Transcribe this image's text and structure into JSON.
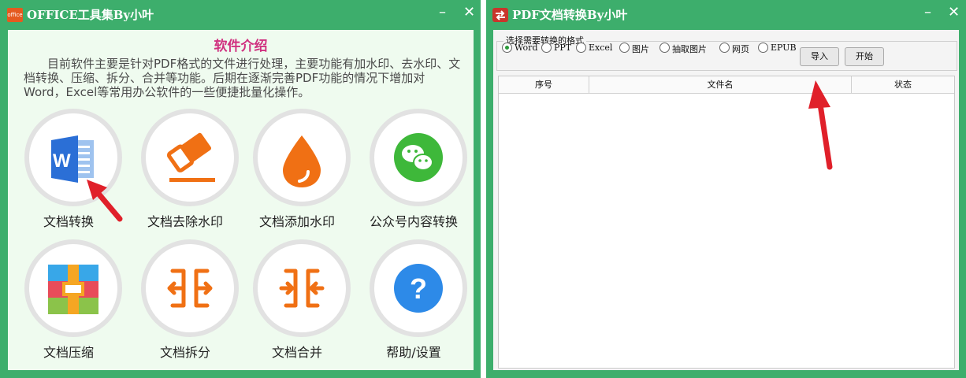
{
  "window_left": {
    "title": "OFFICE工具集By小叶",
    "logo_text": "office",
    "minimize": "–",
    "close": "✕",
    "intro_title": "软件介绍",
    "intro_text": "目前软件主要是针对PDF格式的文件进行处理，主要功能有加水印、去水印、文档转换、压缩、拆分、合并等功能。后期在逐渐完善PDF功能的情况下增加对Word，Excel等常用办公软件的一些便捷批量化操作。",
    "tools": [
      {
        "label": "文档转换",
        "icon": "word-icon"
      },
      {
        "label": "文档去除水印",
        "icon": "eraser-icon"
      },
      {
        "label": "文档添加水印",
        "icon": "water-drop-icon"
      },
      {
        "label": "公众号内容转换",
        "icon": "wechat-icon"
      },
      {
        "label": "文档压缩",
        "icon": "archive-icon"
      },
      {
        "label": "文档拆分",
        "icon": "split-icon"
      },
      {
        "label": "文档合并",
        "icon": "merge-icon"
      },
      {
        "label": "帮助/设置",
        "icon": "help-icon"
      }
    ]
  },
  "window_right": {
    "title": "PDF文档转换By小叶",
    "minimize": "–",
    "close": "✕",
    "format_group_label": "选择需要转换的格式",
    "formats": [
      "Word",
      "PPT",
      "Excel",
      "图片",
      "抽取图片",
      "网页",
      "EPUB"
    ],
    "selected_format": "Word",
    "import_button": "导入",
    "start_button": "开始",
    "table_headers": [
      "序号",
      "文件名",
      "状态"
    ]
  },
  "colors": {
    "window_green": "#3dae6c",
    "title_pink": "#d0307f",
    "arrow_red": "#e0202a",
    "icon_orange": "#f07014"
  }
}
